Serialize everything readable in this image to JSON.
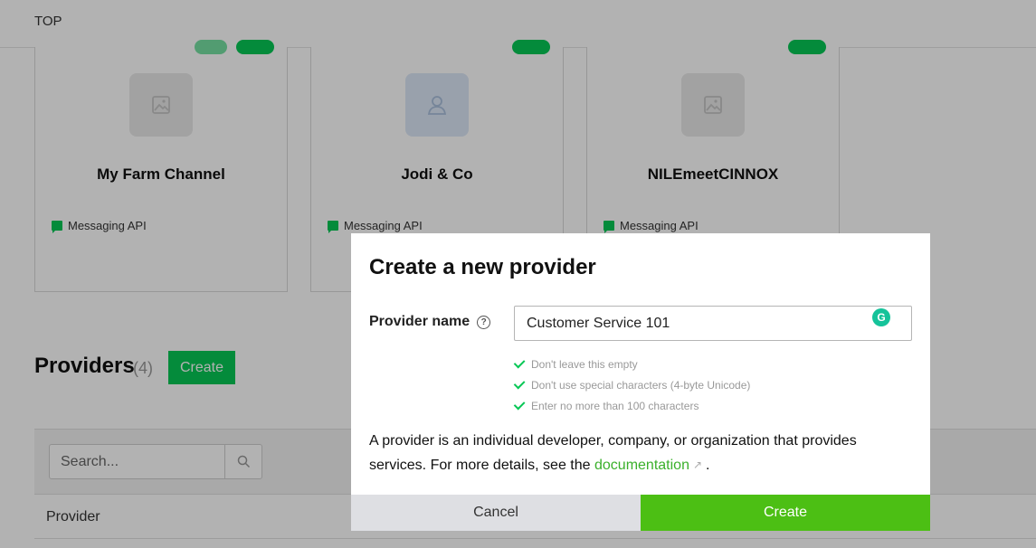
{
  "breadcrumb": "TOP",
  "channels": [
    {
      "name": "My Farm Channel",
      "type": "Messaging API",
      "avatar_icon": "image-placeholder-icon"
    },
    {
      "name": "Jodi & Co",
      "type": "Messaging API",
      "avatar_icon": "person-icon"
    },
    {
      "name": "NILEmeetCINNOX",
      "type": "Messaging API",
      "avatar_icon": "image-placeholder-icon"
    }
  ],
  "providers": {
    "title": "Providers",
    "count": "(4)",
    "create_label": "Create",
    "search_placeholder": "Search...",
    "column_provider": "Provider"
  },
  "modal": {
    "title": "Create a new provider",
    "field_label": "Provider name",
    "field_value": "Customer Service 101",
    "rules": [
      "Don't leave this empty",
      "Don't use special characters (4-byte Unicode)",
      "Enter no more than 100 characters"
    ],
    "desc_text": "A provider is an individual developer, company, or organization that provides services. For more details, see the",
    "desc_link": "documentation",
    "desc_end": ".",
    "cancel_label": "Cancel",
    "create_label": "Create"
  },
  "colors": {
    "brand_green": "#06c755",
    "create_button": "#4cbf14",
    "link_green": "#3ab02b",
    "grammarly": "#15c39a"
  }
}
